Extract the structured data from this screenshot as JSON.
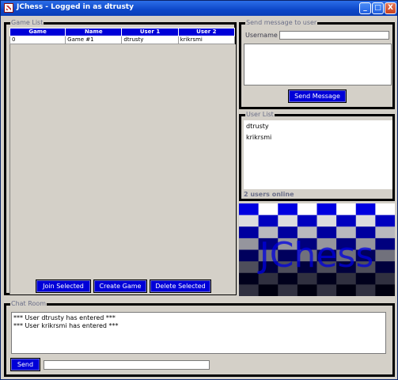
{
  "window": {
    "title": "JChess - Logged in as dtrusty",
    "minimize": "_",
    "maximize": "□",
    "close": "X"
  },
  "game_list": {
    "title": "Game List",
    "columns": [
      "Game",
      "Name",
      "User 1",
      "User 2"
    ],
    "rows": [
      [
        "0",
        "Game #1",
        "dtrusty",
        "krikrsmi"
      ]
    ],
    "buttons": {
      "join": "Join Selected",
      "create": "Create Game",
      "delete": "Delete Selected"
    }
  },
  "send_message": {
    "title": "Send message to user",
    "username_label": "Username",
    "username_value": "",
    "message_value": "",
    "send_button": "Send Message"
  },
  "user_list": {
    "title": "User List",
    "users": [
      "dtrusty",
      "krikrsmi"
    ],
    "status": "2 users online"
  },
  "logo": {
    "text": "JChess",
    "colors": {
      "blue": "#0000e0",
      "dark": "#000010",
      "light": "#ffffff"
    }
  },
  "chat_room": {
    "title": "Chat Room",
    "lines": [
      "*** User dtrusty has entered ***",
      "*** User krikrsmi has entered ***"
    ],
    "send_button": "Send",
    "input_value": ""
  }
}
